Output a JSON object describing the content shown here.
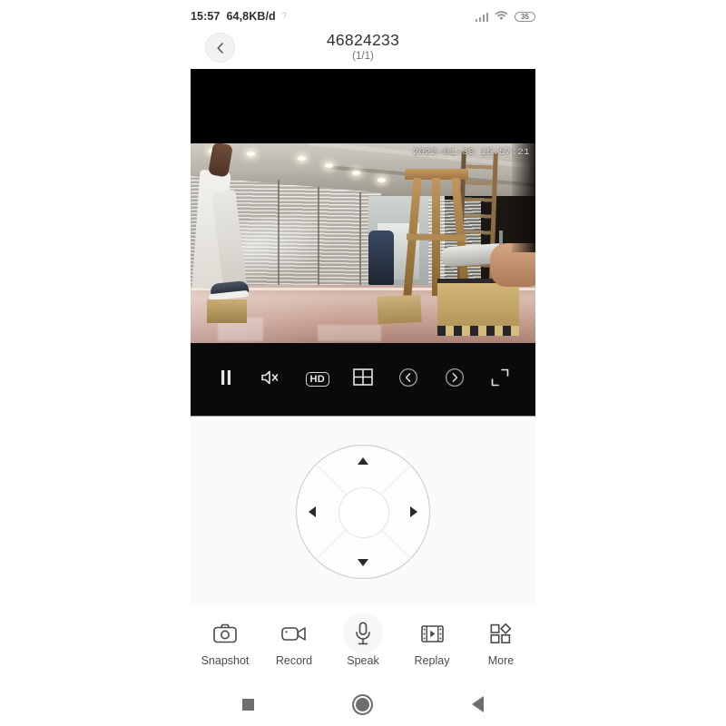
{
  "status_bar": {
    "time": "15:57",
    "network_speed": "64,8KB/d",
    "unknown_indicator": "?",
    "battery_level": "35"
  },
  "header": {
    "back_label": "chevron-left",
    "title": "46824233",
    "subtitle": "(1/1)"
  },
  "video": {
    "timestamp_overlay": "2022-01-30 15:57:21"
  },
  "video_controls": {
    "items": [
      {
        "name": "pause",
        "label": "Pause",
        "icon": "pause-icon"
      },
      {
        "name": "mute",
        "label": "Mute",
        "icon": "speaker-mute-icon"
      },
      {
        "name": "quality",
        "label": "HD",
        "icon": "hd-badge-icon"
      },
      {
        "name": "split-screen",
        "label": "Split screen",
        "icon": "grid-four-icon"
      },
      {
        "name": "previous",
        "label": "Previous",
        "icon": "chevron-left-circle-icon"
      },
      {
        "name": "next",
        "label": "Next",
        "icon": "chevron-right-circle-icon"
      },
      {
        "name": "fullscreen",
        "label": "Fullscreen",
        "icon": "fullscreen-icon"
      }
    ]
  },
  "ptz": {
    "up": "Tilt up",
    "down": "Tilt down",
    "left": "Pan left",
    "right": "Pan right",
    "center": "Center"
  },
  "actions": [
    {
      "label": "Snapshot",
      "icon": "camera-icon"
    },
    {
      "label": "Record",
      "icon": "camcorder-icon"
    },
    {
      "label": "Speak",
      "icon": "microphone-icon"
    },
    {
      "label": "Replay",
      "icon": "film-play-icon"
    },
    {
      "label": "More",
      "icon": "more-grid-icon"
    }
  ],
  "navbar": [
    {
      "label": "Recents",
      "icon": "square-icon"
    },
    {
      "label": "Home",
      "icon": "circle-icon"
    },
    {
      "label": "Back",
      "icon": "triangle-left-icon"
    }
  ],
  "colors": {
    "page_bg": "#ffffff",
    "panel_bg": "#fafafa",
    "control_bar_bg": "#0a0a0a",
    "text_primary": "#313131",
    "text_secondary": "#6f6f6f"
  }
}
